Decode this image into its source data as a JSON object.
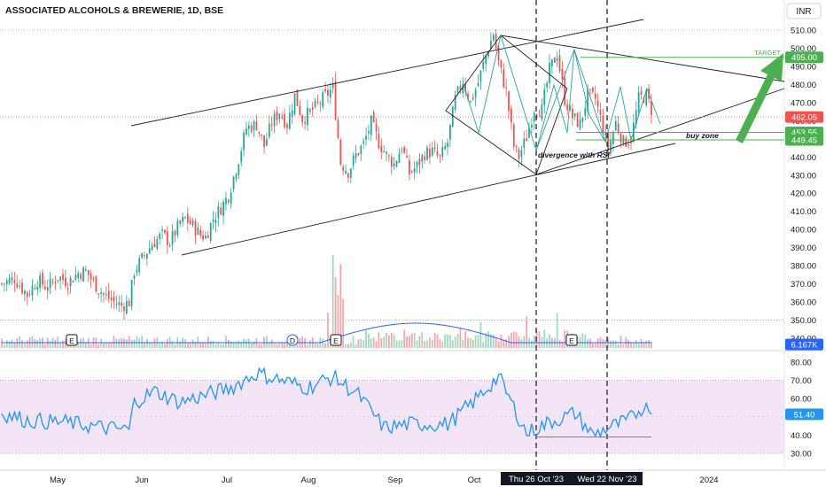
{
  "title": "ASSOCIATED ALCOHOLS & BREWERIE, 1D, BSE",
  "currency": "INR",
  "colors": {
    "up": "#26a69a",
    "down": "#ef5350",
    "volume_up": "#9fd9bf",
    "volume_down": "#f5a6ab",
    "volume_ma": "#2962ff",
    "rsi": "#2196f3",
    "rsi_band": "#f3e5f5",
    "trendline": "#222222",
    "pattern": "#26a69a",
    "zone": "#4caf50",
    "last_price": "#ef5350",
    "volume_badge": "#2962ff"
  },
  "chart_data": [
    {
      "type": "candlestick",
      "panel": "price",
      "yaxis": {
        "min": 340,
        "max": 510,
        "ticks": [
          "510.00",
          "500.00",
          "490.00",
          "480.00",
          "470.00",
          "460.00",
          "450.00",
          "440.00",
          "430.00",
          "420.00",
          "410.00",
          "400.00",
          "390.00",
          "380.00",
          "370.00",
          "360.00",
          "350.00",
          "340.00"
        ]
      },
      "xaxis_labels": [
        "May",
        "Jun",
        "Jul",
        "Aug",
        "Sep",
        "Oct",
        "2024"
      ],
      "series": [
        {
          "role": "price-path",
          "points": [
            [
              0,
              370
            ],
            [
              5,
              373
            ],
            [
              10,
              364
            ],
            [
              14,
              372
            ],
            [
              18,
              368
            ],
            [
              22,
              374
            ],
            [
              26,
              371
            ],
            [
              30,
              376
            ],
            [
              33,
              377
            ],
            [
              37,
              369
            ],
            [
              40,
              364
            ],
            [
              44,
              360
            ],
            [
              47,
              358
            ],
            [
              50,
              360
            ],
            [
              52,
              377
            ],
            [
              56,
              386
            ],
            [
              59,
              392
            ],
            [
              63,
              397
            ],
            [
              66,
              393
            ],
            [
              69,
              401
            ],
            [
              72,
              406
            ],
            [
              75,
              402
            ],
            [
              78,
              397
            ],
            [
              80,
              396
            ],
            [
              83,
              406
            ],
            [
              86,
              412
            ],
            [
              89,
              419
            ],
            [
              93,
              439
            ],
            [
              96,
              456
            ],
            [
              100,
              458
            ],
            [
              103,
              446
            ],
            [
              106,
              459
            ],
            [
              109,
              465
            ],
            [
              112,
              458
            ],
            [
              115,
              474
            ],
            [
              118,
              461
            ],
            [
              122,
              466
            ],
            [
              126,
              472
            ],
            [
              130,
              478
            ],
            [
              133,
              437
            ],
            [
              136,
              432
            ],
            [
              139,
              441
            ],
            [
              142,
              447
            ],
            [
              145,
              459
            ],
            [
              148,
              448
            ],
            [
              151,
              441
            ],
            [
              154,
              436
            ],
            [
              157,
              446
            ],
            [
              160,
              431
            ],
            [
              163,
              435
            ],
            [
              166,
              442
            ],
            [
              169,
              443
            ],
            [
              172,
              439
            ],
            [
              175,
              448
            ],
            [
              178,
              472
            ],
            [
              181,
              482
            ],
            [
              184,
              470
            ],
            [
              187,
              481
            ],
            [
              190,
              496
            ],
            [
              193,
              508
            ],
            [
              195,
              492
            ],
            [
              198,
              476
            ],
            [
              201,
              446
            ],
            [
              203,
              440
            ],
            [
              206,
              451
            ],
            [
              209,
              467
            ],
            [
              212,
              466
            ],
            [
              215,
              488
            ],
            [
              218,
              497
            ],
            [
              221,
              472
            ],
            [
              224,
              462
            ],
            [
              227,
              458
            ],
            [
              230,
              474
            ],
            [
              233,
              472
            ],
            [
              236,
              456
            ],
            [
              238,
              444
            ],
            [
              241,
              459
            ],
            [
              244,
              448
            ],
            [
              247,
              450
            ],
            [
              250,
              472
            ],
            [
              253,
              474
            ],
            [
              256,
              462
            ]
          ]
        },
        {
          "name": "Volume",
          "role": "volume",
          "value_badge": "6.167K"
        }
      ],
      "annotations": [
        {
          "text": "TARGET",
          "price": 495.0,
          "label": "495.00"
        },
        {
          "text": "buy zone",
          "upper": 453.55,
          "lower": 449.45
        },
        {
          "text": "divergence with RSI"
        },
        {
          "price": 462.05,
          "label": "462.05"
        },
        {
          "event": "E"
        },
        {
          "event": "D"
        },
        {
          "vertical_line_date": "Thu 26 Oct '23"
        },
        {
          "vertical_line_date": "Wed 22 Nov '23"
        }
      ],
      "markers": [
        "E",
        "D",
        "E",
        "E"
      ],
      "badges": {
        "target_label": "TARGET",
        "target_price": "495.00",
        "zone_upper": "453.55",
        "zone_lower": "449.45",
        "last_price": "462.05",
        "volume": "6.167K",
        "zone_text": "buy zone",
        "div_text": "divergence with RSI"
      }
    },
    {
      "type": "line",
      "panel": "rsi",
      "name": "RSI",
      "yaxis": {
        "min": 30,
        "max": 80,
        "ticks": [
          "80.00",
          "70.00",
          "60.00",
          "50.00",
          "40.00",
          "30.00"
        ]
      },
      "bands": [
        30,
        70
      ],
      "current_value": 51.4,
      "current_label": "51.40",
      "dates": [
        "Thu 26 Oct '23",
        "Wed 22 Nov '23"
      ]
    }
  ]
}
